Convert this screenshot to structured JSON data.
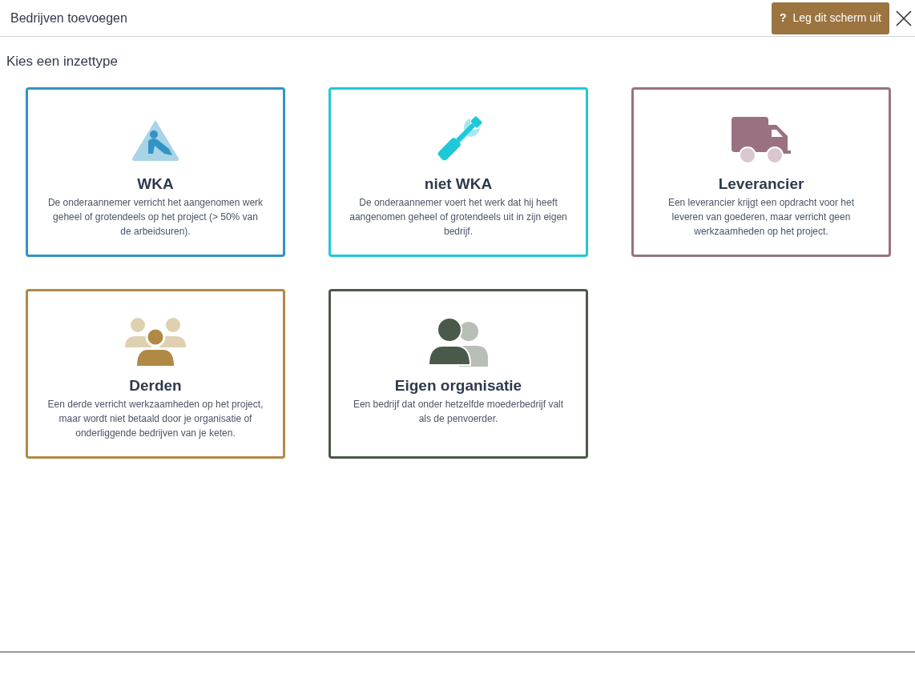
{
  "header": {
    "title": "Bedrijven toevoegen",
    "help_button": {
      "icon": "?",
      "label": "Leg dit scherm uit"
    }
  },
  "section_title": "Kies een inzettype",
  "cards": [
    {
      "kind": "worker",
      "color": "#3393c4",
      "title": "WKA",
      "description": "De onderaannemer verricht het aangenomen werk geheel of grotendeels op het project (> 50% van de arbeidsuren)."
    },
    {
      "kind": "tools",
      "color": "#1fc8d8",
      "title": "niet WKA",
      "description": "De onderaannemer voert het werk dat hij heeft aangenomen geheel of grotendeels uit in zijn eigen bedrijf."
    },
    {
      "kind": "truck",
      "color": "#9a7183",
      "title": "Leverancier",
      "description": "Een leverancier krijgt een opdracht voor het leveren van goederen, maar verricht geen werkzaamheden op het project."
    },
    {
      "kind": "group",
      "color": "#b08a45",
      "title": "Derden",
      "description": "Een derde verricht werkzaamheden op het project, maar wordt niet betaald door je organisatie of onderliggende bedrijven van je keten."
    },
    {
      "kind": "pair",
      "color": "#4a5a4a",
      "title": "Eigen organisatie",
      "description": "Een bedrijf dat onder hetzelfde moederbedrijf valt als de penvoerder."
    }
  ]
}
